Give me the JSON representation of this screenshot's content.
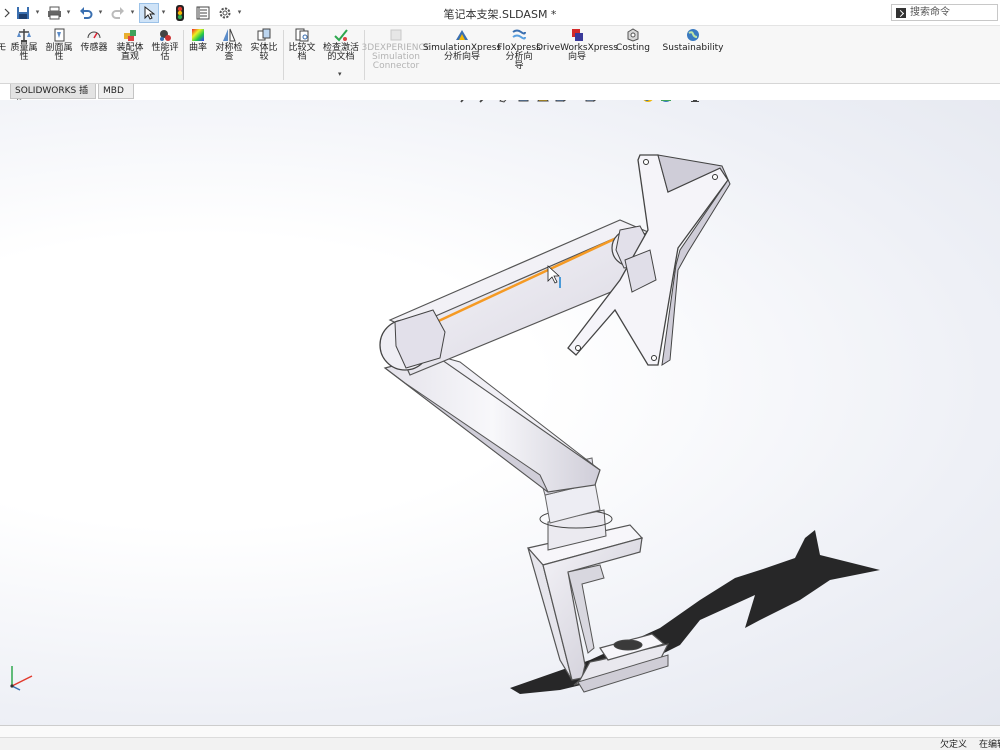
{
  "window": {
    "document_title": "笔记本支架.SLDASM *",
    "search": {
      "placeholder": "搜索命令",
      "value": ""
    }
  },
  "quick_access": [
    {
      "name": "save-icon"
    },
    {
      "name": "print-icon"
    },
    {
      "name": "undo-icon"
    },
    {
      "name": "redo-icon"
    },
    {
      "name": "select-arrow-icon"
    },
    {
      "name": "rebuild-traffic-light-icon"
    },
    {
      "name": "file-properties-icon"
    },
    {
      "name": "options-gear-icon"
    }
  ],
  "ribbon": {
    "buttons": [
      {
        "id": "partial",
        "label": "モ"
      },
      {
        "id": "mass-properties",
        "label_lines": [
          "质量属",
          "性"
        ]
      },
      {
        "id": "section-properties",
        "label_lines": [
          "剖面属",
          "性"
        ]
      },
      {
        "id": "sensor",
        "label_lines": [
          "传感器"
        ]
      },
      {
        "id": "assembly-visualization",
        "label_lines": [
          "装配体",
          "直观"
        ]
      },
      {
        "id": "performance-evaluation",
        "label_lines": [
          "性能评",
          "估"
        ]
      },
      {
        "id": "curvature",
        "label_lines": [
          "曲率"
        ]
      },
      {
        "id": "symmetry-check",
        "label_lines": [
          "对称检",
          "查"
        ]
      },
      {
        "id": "compare-bodies",
        "label_lines": [
          "实体比",
          "较"
        ]
      },
      {
        "id": "compare-documents",
        "label_lines": [
          "比较文",
          "档"
        ]
      },
      {
        "id": "check-active-document",
        "label_lines": [
          "检查激活",
          "的文档"
        ]
      },
      {
        "id": "3dexperience-connector",
        "label_lines": [
          "3DEXPERIENCE",
          "Simulation",
          "Connector"
        ],
        "disabled": true
      },
      {
        "id": "simulationxpress",
        "label_lines": [
          "SimulationXpress",
          "分析向导"
        ]
      },
      {
        "id": "floxpress",
        "label_lines": [
          "FloXpress",
          "分析向",
          "导"
        ]
      },
      {
        "id": "driveworksxpress",
        "label_lines": [
          "DriveWorksXpress",
          "向导"
        ]
      },
      {
        "id": "costing",
        "label_lines": [
          "Costing"
        ]
      },
      {
        "id": "sustainability",
        "label_lines": [
          "Sustainability"
        ]
      }
    ]
  },
  "tabs": [
    {
      "label": "SOLIDWORKS 插件",
      "active": true
    },
    {
      "label": "MBD",
      "active": false
    }
  ],
  "heads_up_toolbar": [
    {
      "name": "zoom-to-fit-icon"
    },
    {
      "name": "zoom-to-area-icon"
    },
    {
      "name": "previous-view-icon"
    },
    {
      "name": "section-view-icon"
    },
    {
      "name": "dynamic-annotation-icon"
    },
    {
      "name": "view-orientation-icon"
    },
    {
      "name": "display-style-icon"
    },
    {
      "name": "hide-show-items-icon"
    },
    {
      "name": "edit-appearance-icon"
    },
    {
      "name": "apply-scene-icon"
    },
    {
      "name": "view-settings-icon"
    }
  ],
  "status": {
    "custom": "欠定义",
    "editing": "在编辑"
  },
  "colors": {
    "accent_select": "#cfe3f7",
    "highlight_edge": "#f59a23",
    "part_fill": "#ecebf1",
    "shadow": "#141414"
  }
}
